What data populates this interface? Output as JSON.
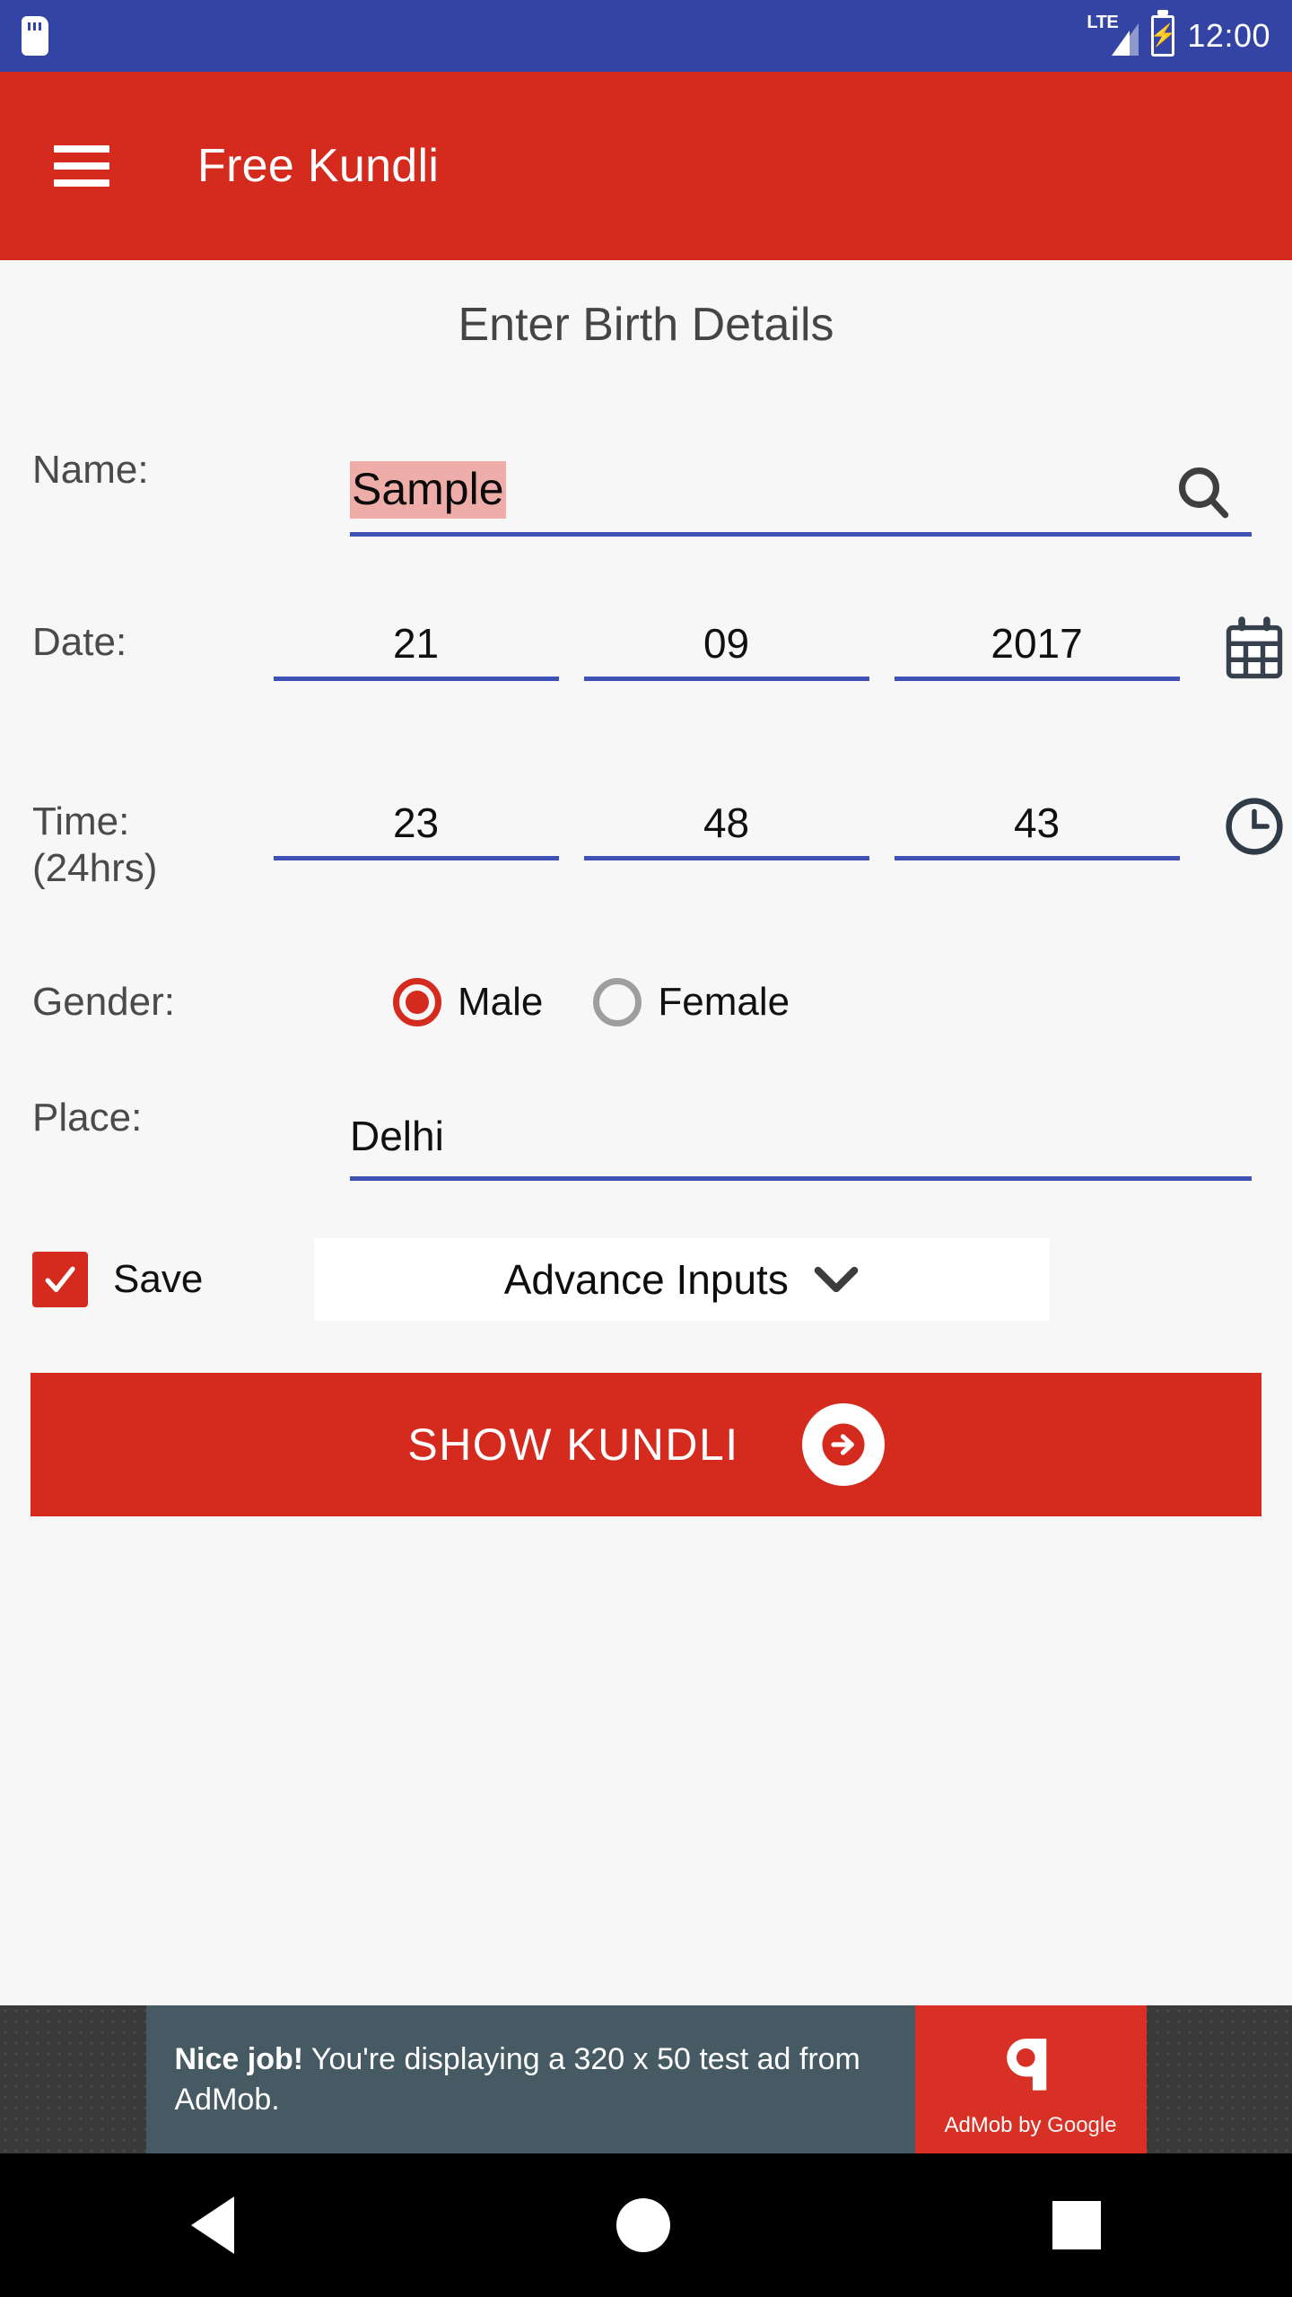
{
  "status_bar": {
    "sim_icon": "sim-card-icon",
    "network_label": "LTE",
    "signal_icon": "signal-bars-icon",
    "battery_icon": "battery-charging-icon",
    "time": "12:00"
  },
  "app_bar": {
    "menu_icon": "hamburger-menu-icon",
    "title": "Free Kundli",
    "background_color": "#d42b1e"
  },
  "form": {
    "heading": "Enter Birth Details",
    "name": {
      "label": "Name:",
      "value": "Sample",
      "selection_color": "#eeada8",
      "search_icon": "search-icon"
    },
    "date": {
      "label": "Date:",
      "day": "21",
      "month": "09",
      "year": "2017",
      "calendar_icon": "calendar-icon"
    },
    "time": {
      "label": "Time:",
      "sublabel": "(24hrs)",
      "hour": "23",
      "minute": "48",
      "second": "43",
      "clock_icon": "clock-icon"
    },
    "gender": {
      "label": "Gender:",
      "options": [
        {
          "label": "Male",
          "selected": true
        },
        {
          "label": "Female",
          "selected": false
        }
      ]
    },
    "place": {
      "label": "Place:",
      "value": "Delhi"
    },
    "save": {
      "label": "Save",
      "checked": true,
      "check_icon": "checkmark-icon"
    },
    "advance": {
      "label": "Advance Inputs",
      "chevron_icon": "chevron-down-icon"
    },
    "submit": {
      "label": "SHOW KUNDLI",
      "arrow_icon": "arrow-right-circle-icon"
    },
    "underline_color": "#3f51b5"
  },
  "ad": {
    "headline": "Nice job!",
    "body": "You're displaying a 320 x 50 test ad from AdMob.",
    "brand_prefix": "AdMob by ",
    "brand_suffix": "Google",
    "logo_icon": "admob-logo-icon"
  },
  "nav_bar": {
    "back_icon": "back-triangle-icon",
    "home_icon": "home-circle-icon",
    "recents_icon": "recents-square-icon"
  }
}
